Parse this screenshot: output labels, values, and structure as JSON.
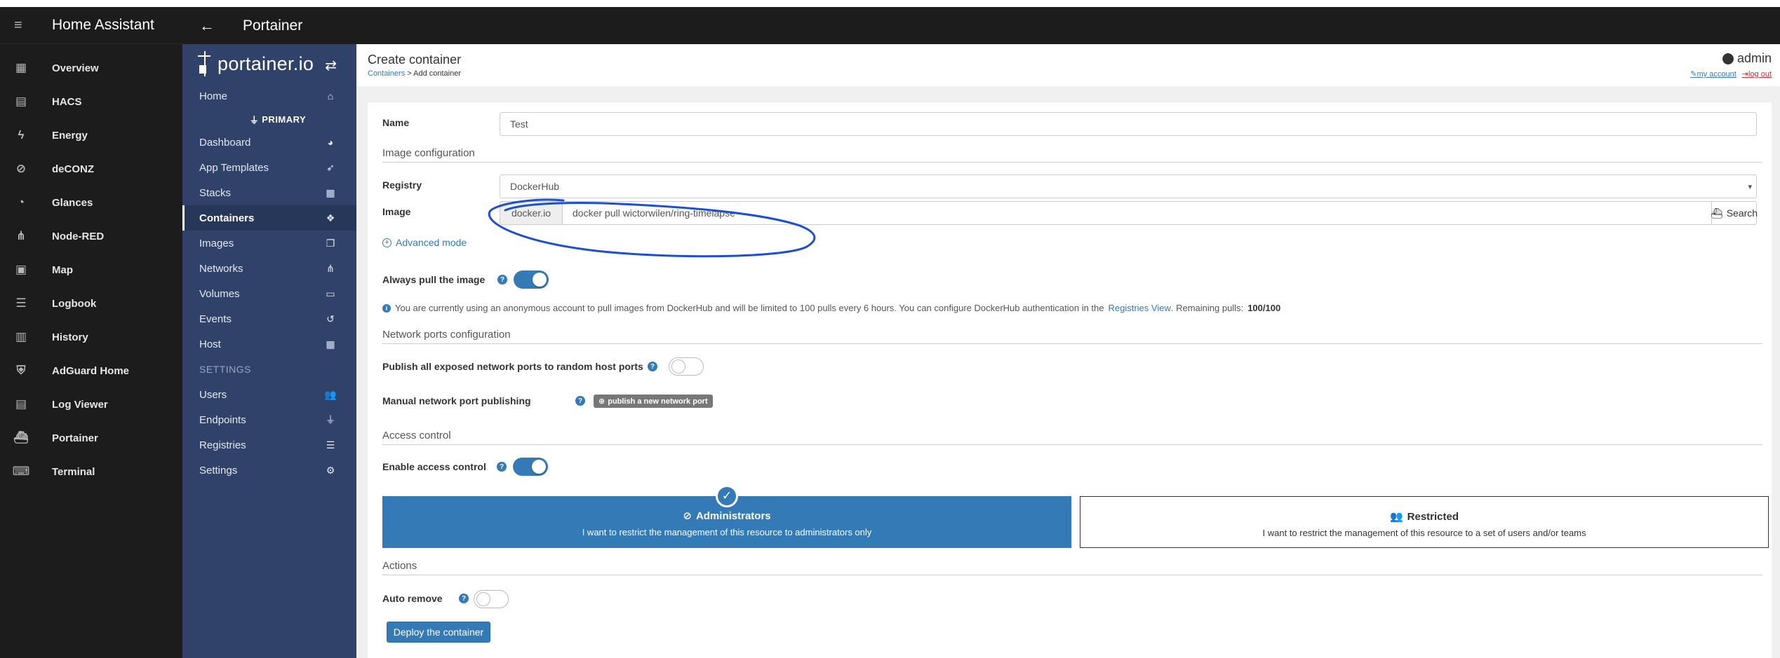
{
  "ha": {
    "title": "Home Assistant",
    "items": [
      {
        "label": "Overview",
        "icon": "dashboard-icon"
      },
      {
        "label": "HACS",
        "icon": "hacs-icon"
      },
      {
        "label": "Energy",
        "icon": "lightning-icon"
      },
      {
        "label": "deCONZ",
        "icon": "zigbee-icon"
      },
      {
        "label": "Glances",
        "icon": "gauge-icon"
      },
      {
        "label": "Node-RED",
        "icon": "sitemap-icon"
      },
      {
        "label": "Map",
        "icon": "map-icon"
      },
      {
        "label": "Logbook",
        "icon": "list-icon"
      },
      {
        "label": "History",
        "icon": "chart-icon"
      },
      {
        "label": "AdGuard Home",
        "icon": "shield-icon"
      },
      {
        "label": "Log Viewer",
        "icon": "document-icon"
      },
      {
        "label": "Portainer",
        "icon": "docker-icon"
      },
      {
        "label": "Terminal",
        "icon": "terminal-icon"
      }
    ]
  },
  "topbar": {
    "title": "Portainer"
  },
  "portainer": {
    "logo": "portainer.io",
    "home": "Home",
    "endpoint": "PRIMARY",
    "items": [
      "Dashboard",
      "App Templates",
      "Stacks",
      "Containers",
      "Images",
      "Networks",
      "Volumes",
      "Events",
      "Host"
    ],
    "settings_label": "SETTINGS",
    "settings_items": [
      "Users",
      "Endpoints",
      "Registries",
      "Settings"
    ]
  },
  "header": {
    "title": "Create container",
    "crumb_link": "Containers",
    "crumb_rest": " > Add container",
    "user": "admin",
    "my_account": "my account",
    "log_out": "log out"
  },
  "form": {
    "name_label": "Name",
    "name_value": "Test",
    "image_config": "Image configuration",
    "registry_label": "Registry",
    "registry_value": "DockerHub",
    "image_label": "Image",
    "image_prefix": "docker.io",
    "image_value": "docker pull wictorwilen/ring-timelapse",
    "search_label": "Search",
    "advanced_mode": "Advanced mode",
    "always_pull_label": "Always pull the image",
    "always_pull": true,
    "note_text": "You are currently using an anonymous account to pull images from DockerHub and will be limited to 100 pulls every 6 hours. You can configure DockerHub authentication in the",
    "note_link": "Registries View",
    "note_tail": ". Remaining pulls:",
    "remaining_pulls": "100/100",
    "network_section": "Network ports configuration",
    "publish_all_label": "Publish all exposed network ports to random host ports",
    "publish_all": false,
    "manual_label": "Manual network port publishing",
    "publish_button": "publish a new network port",
    "access_section": "Access control",
    "enable_access_label": "Enable access control",
    "enable_access": true,
    "admin_title": "Administrators",
    "admin_desc": "I want to restrict the management of this resource to administrators only",
    "restricted_title": "Restricted",
    "restricted_desc": "I want to restrict the management of this resource to a set of users and/or teams",
    "actions_section": "Actions",
    "auto_remove_label": "Auto remove",
    "auto_remove": false,
    "deploy_button": "Deploy the container"
  },
  "colors": {
    "accent": "#337ab7",
    "portainer_sidebar": "#30426a",
    "ha_sidebar": "#1c1c1c",
    "annotation": "#1d4fcf"
  }
}
